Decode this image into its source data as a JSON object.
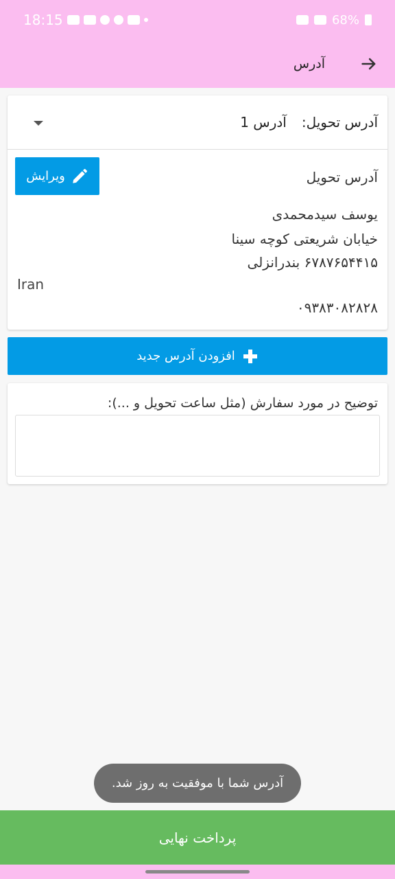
{
  "status_bar": {
    "time": "18:15",
    "battery": "68%"
  },
  "app_bar": {
    "title": "آدرس"
  },
  "delivery": {
    "label": "آدرس تحویل:",
    "selected": "آدرس 1"
  },
  "address_card": {
    "title": "آدرس تحویل",
    "edit_label": "ویرایش",
    "name": "یوسف سیدمحمدی",
    "street": "خیابان شریعتی کوچه سینا",
    "postal_city": "۶۷۸۷۶۵۴۴۱۵ بندرانزلی",
    "country": "Iran",
    "phone": "۰۹۳۸۳۰۸۲۸۲۸"
  },
  "add_address_label": "افزودن آدرس جدید",
  "note": {
    "label": "توضیح در مورد سفارش (مثل ساعت تحویل و ...):",
    "value": "",
    "placeholder": ""
  },
  "toast": "آدرس شما با موفقیت به روز شد.",
  "final_payment_label": "پرداخت نهایی",
  "colors": {
    "header_pink": "#fbbdf0",
    "primary_blue": "#039be5",
    "pay_green": "#66bb5f",
    "toast_gray": "#6e6e6e"
  }
}
